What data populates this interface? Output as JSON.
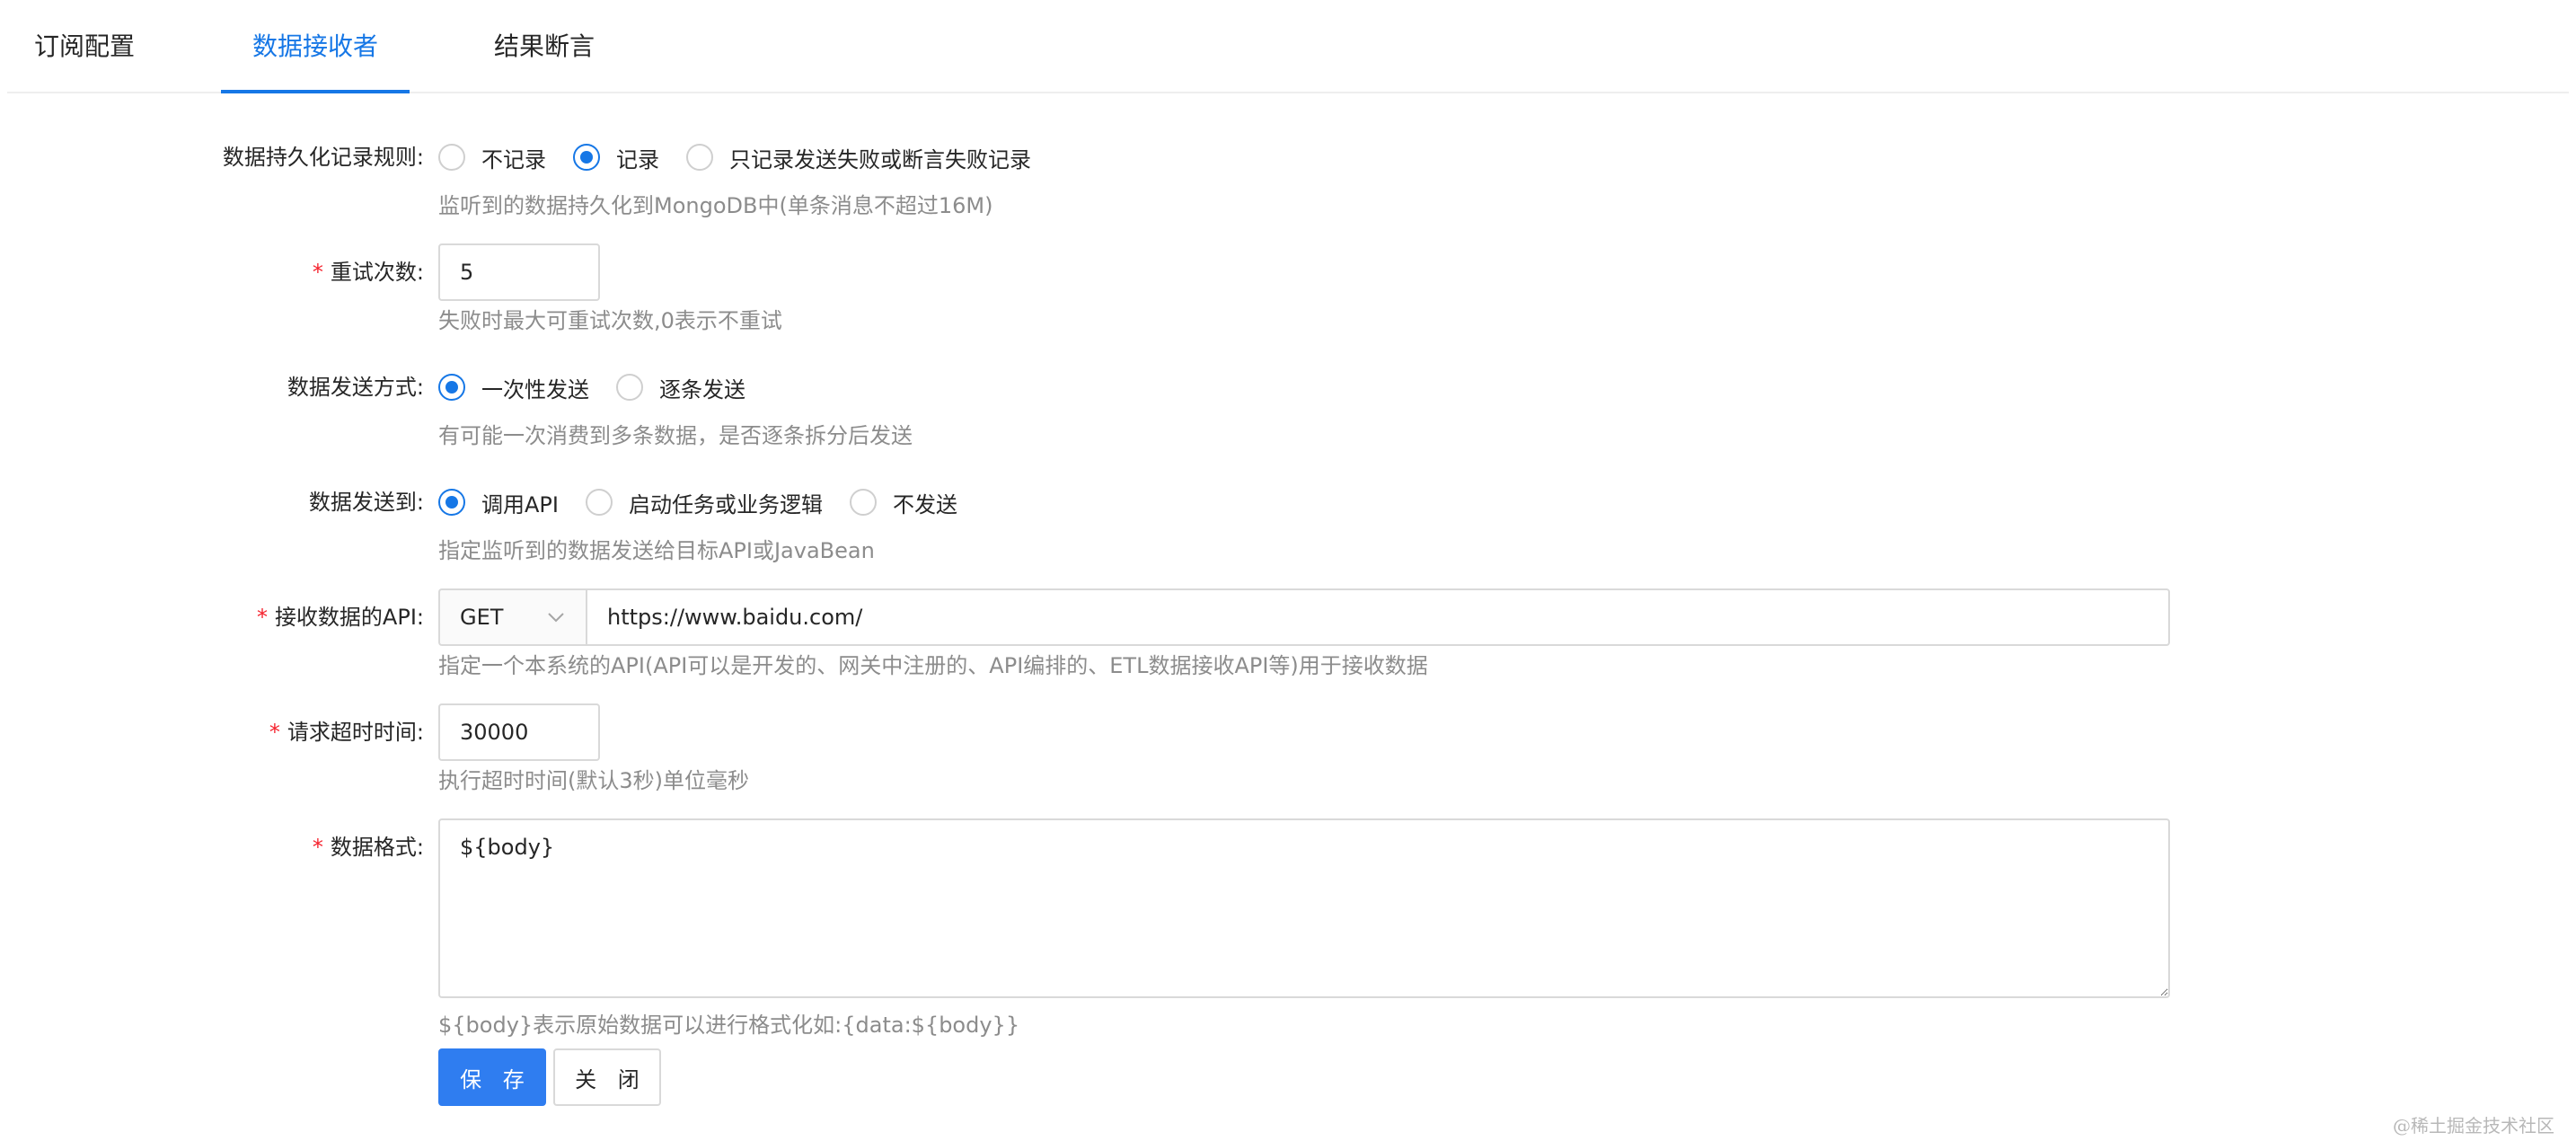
{
  "tabs": [
    {
      "label": "订阅配置",
      "active": false
    },
    {
      "label": "数据接收者",
      "active": true
    },
    {
      "label": "结果断言",
      "active": false
    }
  ],
  "form": {
    "persist": {
      "label": "数据持久化记录规则:",
      "options": [
        "不记录",
        "记录",
        "只记录发送失败或断言失败记录"
      ],
      "selected": "记录",
      "help": "监听到的数据持久化到MongoDB中(单条消息不超过16M)"
    },
    "retry": {
      "label": "重试次数:",
      "value": "5",
      "help": "失败时最大可重试次数,0表示不重试"
    },
    "send_mode": {
      "label": "数据发送方式:",
      "options": [
        "一次性发送",
        "逐条发送"
      ],
      "selected": "一次性发送",
      "help": "有可能一次消费到多条数据，是否逐条拆分后发送"
    },
    "send_to": {
      "label": "数据发送到:",
      "options": [
        "调用API",
        "启动任务或业务逻辑",
        "不发送"
      ],
      "selected": "调用API",
      "help": "指定监听到的数据发送给目标API或JavaBean"
    },
    "api": {
      "label": "接收数据的API:",
      "method": "GET",
      "url": "https://www.baidu.com/",
      "help": "指定一个本系统的API(API可以是开发的、网关中注册的、API编排的、ETL数据接收API等)用于接收数据"
    },
    "timeout": {
      "label": "请求超时时间:",
      "value": "30000",
      "help": "执行超时时间(默认3秒)单位毫秒"
    },
    "format": {
      "label": "数据格式:",
      "value": "${body}",
      "help": "${body}表示原始数据可以进行格式化如:{data:${body}}"
    }
  },
  "actions": {
    "save_label": "保 存",
    "close_label": "关 闭"
  },
  "colors": {
    "accent": "#1677e6",
    "required": "#f5222d",
    "help_text": "#8c8c8c"
  },
  "watermark": "@稀土掘金技术社区"
}
